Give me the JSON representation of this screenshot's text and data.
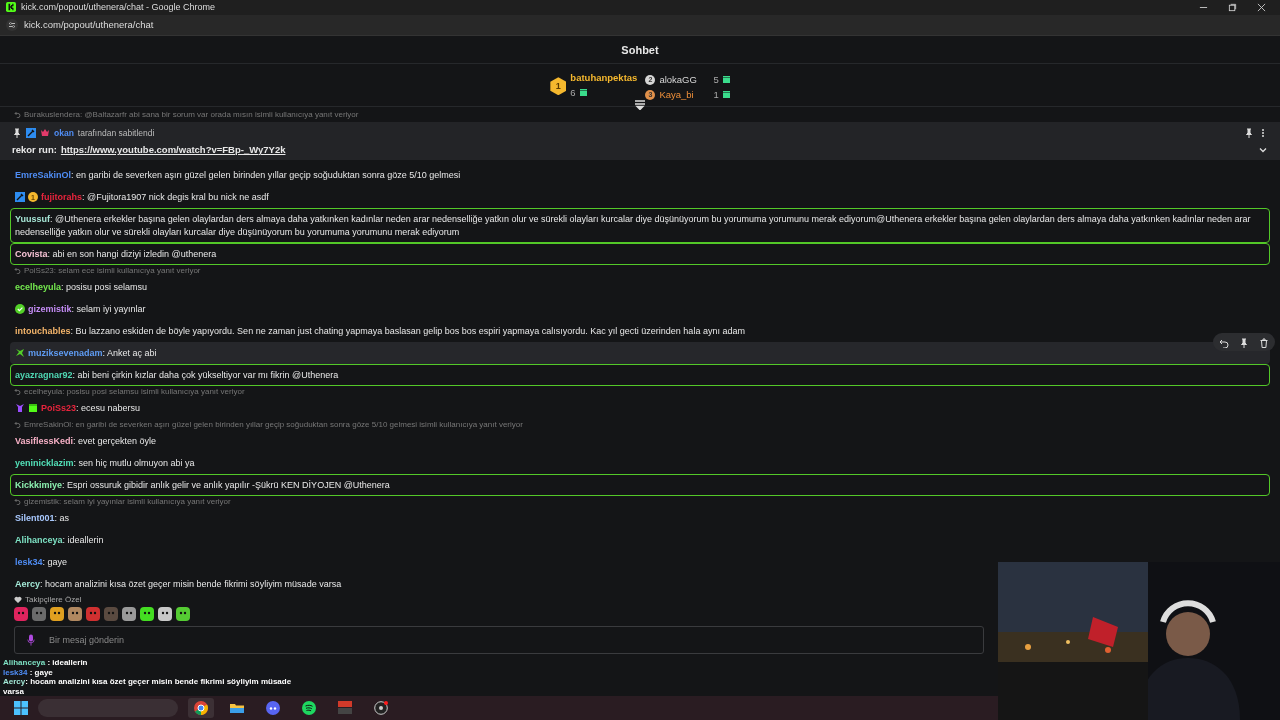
{
  "window": {
    "title": "kick.com/popout/uthenera/chat - Google Chrome",
    "address": "kick.com/popout/uthenera/chat"
  },
  "chat_title": "Sohbet",
  "leaderboard": [
    {
      "rank": "1",
      "name": "batuhanpektas",
      "count": "6"
    },
    {
      "rank": "2",
      "name": "alokaGG",
      "count": "5"
    },
    {
      "rank": "3",
      "name": "Kaya_bi",
      "count": "1"
    }
  ],
  "top_reply": "Burakuslendera: @Baltazarfr abi sana bir sorum var orada mısın isimli kullanıcıya yanıt veriyor",
  "pinned": {
    "pinned_by": "okan",
    "suffix": "tarafından sabitlendi",
    "author": "rekor run:",
    "link": "https://www.youtube.com/watch?v=FBp-_Wy7Y2k"
  },
  "messages": [
    {
      "user": "EmreSakinOl",
      "color": "#4f8df5",
      "text": ": en garibi de severken aşırı güzel gelen birinden yıllar geçip soğuduktan sonra göze 5/10 gelmesi",
      "highlighted": false,
      "hovered": false
    },
    {
      "user": "fujitorahs",
      "color": "#e8243c",
      "text": ": @Fujitora1907 nick degis kral bu nick ne asdf",
      "highlighted": false,
      "hovered": false,
      "badges": [
        {
          "kind": "mod"
        },
        {
          "kind": "gift",
          "label": "1"
        }
      ]
    },
    {
      "user": "Yuussuf",
      "color": "#a6e6d6",
      "text": ": @Uthenera erkekler başına gelen olaylardan ders almaya daha yatkınken kadınlar neden arar nedenselliğe yatkın olur ve sürekli olayları kurcalar diye düşünüyorum bu yorumuma yorumunu merak ediyorum@Uthenera erkekler başına gelen olaylardan ders almaya daha yatkınken kadınlar neden arar nedenselliğe yatkın olur ve sürekli olayları kurcalar diye düşünüyorum bu yorumuma yorumunu merak ediyorum",
      "highlighted": true,
      "hovered": false
    },
    {
      "user": "Covista",
      "color": "#f6c2d4",
      "text": ": abi en son hangi diziyi izledin @uthenera",
      "highlighted": true,
      "hovered": false
    },
    {
      "reply": "PoiSs23: selam ece isimli kullanıcıya yanıt veriyor",
      "user": "ecelheyula",
      "color": "#74e84e",
      "text": ": posisu posi selamsu",
      "highlighted": false,
      "hovered": false
    },
    {
      "user": "gizemistik",
      "color": "#c48cf5",
      "text": ": selam iyi yayınlar",
      "highlighted": false,
      "hovered": false,
      "badges": [
        {
          "kind": "verified"
        }
      ]
    },
    {
      "user": "intouchables",
      "color": "#f3b46a",
      "text": ": Bu lazzano eskiden de böyle yapıyordu. Sen ne zaman just chating yapmaya baslasan gelip bos bos espiri yapmaya calısıyordu. Kac yıl gecti üzerinden hala aynı adam",
      "highlighted": false,
      "hovered": false
    },
    {
      "user": "muziksevenadam",
      "color": "#5f9cf3",
      "text": ": Anket aç abi",
      "highlighted": false,
      "hovered": true,
      "badges": [
        {
          "kind": "og"
        }
      ]
    },
    {
      "user": "ayazragnar92",
      "color": "#4fd8b4",
      "text": ": abi beni çirkin kızlar daha çok yükseltiyor var mı fikrin @Uthenera",
      "highlighted": true,
      "hovered": false
    },
    {
      "reply": "ecelheyula: posisu posi selamsu isimli kullanıcıya yanıt veriyor",
      "user": "PoiSs23",
      "color": "#e8243c",
      "text": ": ecesu nabersu",
      "highlighted": false,
      "hovered": false,
      "badges": [
        {
          "kind": "sub"
        },
        {
          "kind": "gift-box"
        }
      ]
    },
    {
      "reply": "EmreSakinOl: en garibi de severken aşırı güzel gelen birinden yıllar geçip soğuduktan sonra göze 5/10 gelmesi isimli kullanıcıya yanıt veriyor",
      "user": "VasiflessKedi",
      "color": "#f7b0c6",
      "text": ": evet gerçekten öyle",
      "highlighted": false,
      "hovered": false
    },
    {
      "user": "yeninicklazim",
      "color": "#52e0b8",
      "text": ": sen hiç mutlu olmuyon abi ya",
      "highlighted": false,
      "hovered": false
    },
    {
      "user": "Kickkimiye",
      "color": "#8cf0b0",
      "text": ": Espri ossuruk gibidir anlık gelir ve anlık yapılır -Şükrü KEN DİYOJEN @Uthenera",
      "highlighted": true,
      "hovered": false
    },
    {
      "reply": "gizemistik: selam iyi yayınlar isimli kullanıcıya yanıt veriyor",
      "user": "Silent001",
      "color": "#a9c9ff",
      "text": ": as",
      "highlighted": false,
      "hovered": false
    },
    {
      "user": "Alihanceya",
      "color": "#7ee2c4",
      "text": ": ideallerin",
      "highlighted": false,
      "hovered": false
    },
    {
      "user": "lesk34",
      "color": "#4f8df5",
      "text": ": gaye",
      "highlighted": false,
      "hovered": false
    },
    {
      "user": "Aercy",
      "color": "#a2e8d6",
      "text": ": hocam analizini kısa özet geçer misin bende fikrimi söyliyim müsade varsa",
      "highlighted": false,
      "hovered": false
    }
  ],
  "emote_section": "Takipçilere Özel",
  "emotes": [
    {
      "color": "#e0245e"
    },
    {
      "color": "#6b6b6b"
    },
    {
      "color": "#e0a020"
    },
    {
      "color": "#b08860"
    },
    {
      "color": "#d03030"
    },
    {
      "color": "#5a4a40"
    },
    {
      "color": "#9a9a9a"
    },
    {
      "color": "#44dd22"
    },
    {
      "color": "#c8c8c8"
    },
    {
      "color": "#55cc33"
    }
  ],
  "message_input": {
    "placeholder": "Bir mesaj gönderin"
  },
  "overlay_chat": [
    {
      "user": "Alihanceya",
      "color": "#7ee2c4",
      "text": " : ideallerin"
    },
    {
      "user": "lesk34",
      "color": "#4f8df5",
      "text": " : gaye"
    },
    {
      "user": "Aercy",
      "color": "#a2e8d6",
      "text": ": hocam analizini kısa özet geçer misin bende fikrimi söyliyim müsade varsa"
    }
  ],
  "taskbar": [
    {
      "kind": "windows"
    },
    {
      "kind": "search"
    },
    {
      "kind": "browser",
      "selected": true
    },
    {
      "kind": "folder",
      "selected": false
    },
    {
      "kind": "discord",
      "selected": false
    },
    {
      "kind": "music",
      "selected": false
    },
    {
      "kind": "mixer",
      "selected": false
    },
    {
      "kind": "recorder",
      "selected": false
    }
  ]
}
